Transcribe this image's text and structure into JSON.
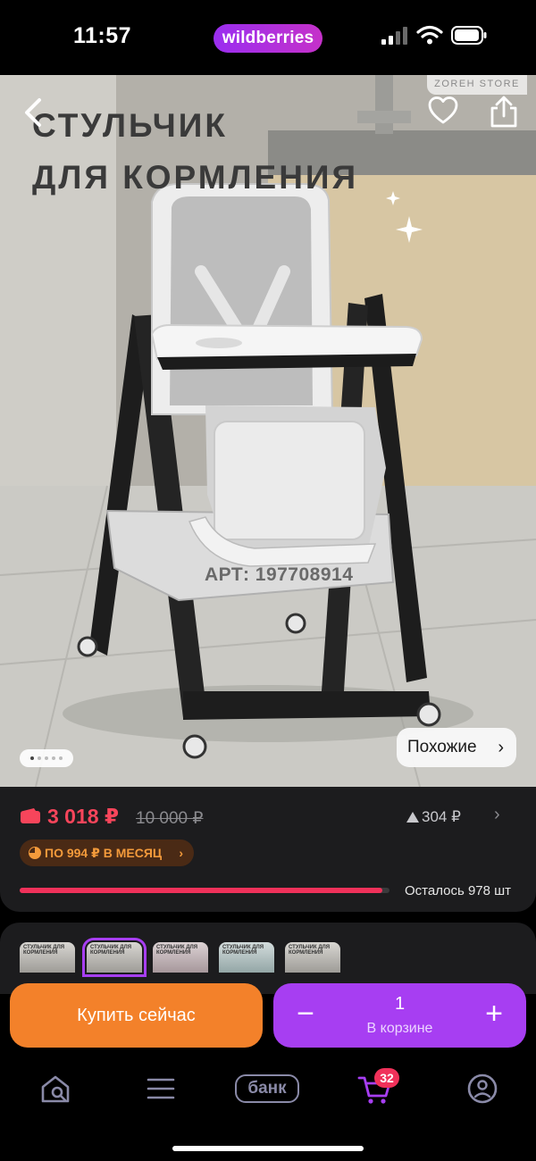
{
  "status_bar": {
    "time": "11:57",
    "app_badge": "wildberries"
  },
  "product": {
    "title_line1": "СТУЛЬЧИК",
    "title_line2": "ДЛЯ КОРМЛЕНИЯ",
    "store_badge": "ZOREH STORE",
    "tray_brand": "ZOREH STORE",
    "article": "АРТ: 197708914",
    "similar_label": "Похожие",
    "image_count": 5,
    "active_image": 1
  },
  "pricing": {
    "price": "3 018 ₽",
    "old_price": "10 000 ₽",
    "bonus": "304 ₽",
    "installment": "ПО 994 ₽ В МЕСЯЦ",
    "stock_label": "Осталось 978 шт",
    "stock_fill_fraction": 0.98
  },
  "thumbnails": [
    {
      "caption": "СТУЛЬЧИК ДЛЯ КОРМЛЕНИЯ",
      "selected": false
    },
    {
      "caption": "СТУЛЬЧИК ДЛЯ КОРМЛЕНИЯ",
      "selected": true
    },
    {
      "caption": "СТУЛЬЧИК ДЛЯ КОРМЛЕНИЯ",
      "selected": false
    },
    {
      "caption": "СТУЛЬЧИК ДЛЯ КОРМЛЕНИЯ",
      "selected": false
    },
    {
      "caption": "СТУЛЬЧИК ДЛЯ КОРМЛЕНИЯ",
      "selected": false
    }
  ],
  "actions": {
    "buy_now": "Купить сейчас",
    "quantity": "1",
    "in_cart": "В корзине",
    "minus": "−",
    "plus": "+"
  },
  "tabbar": {
    "bank_label": "банк",
    "cart_count": "32",
    "icons": [
      "home-search-icon",
      "menu-icon",
      "bank-icon",
      "cart-icon",
      "profile-icon"
    ]
  },
  "colors": {
    "accent_purple": "#a73ef2",
    "buy_orange": "#f3812a",
    "price_red": "#f7455b"
  }
}
